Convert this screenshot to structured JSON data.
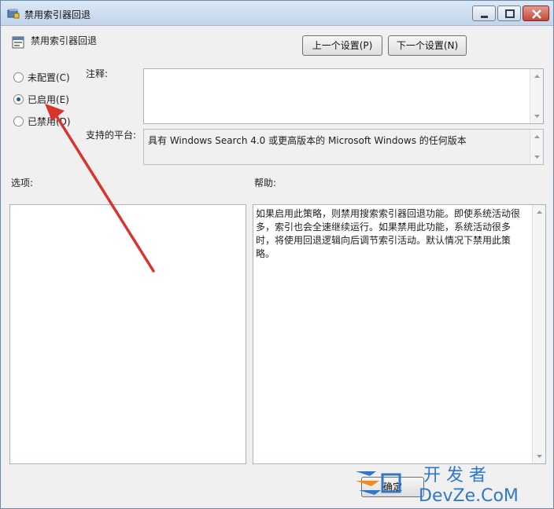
{
  "window": {
    "title": "禁用索引器回退"
  },
  "policy": {
    "name": "禁用索引器回退"
  },
  "nav": {
    "prev_label": "上一个设置(P)",
    "next_label": "下一个设置(N)"
  },
  "options": [
    {
      "label": "未配置(C)",
      "selected": false
    },
    {
      "label": "已启用(E)",
      "selected": true
    },
    {
      "label": "已禁用(D)",
      "selected": false
    }
  ],
  "comment": {
    "label": "注释:",
    "value": ""
  },
  "platform": {
    "label": "支持的平台:",
    "value": "具有 Windows Search 4.0 或更高版本的 Microsoft Windows 的任何版本"
  },
  "sections": {
    "options_label": "选项:",
    "help_label": "帮助:"
  },
  "help": {
    "text": "如果启用此策略，则禁用搜索索引器回退功能。即使系统活动很多，索引也会全速继续运行。如果禁用此功能，系统活动很多时，将使用回退逻辑向后调节索引活动。默认情况下禁用此策略。"
  },
  "footer": {
    "ok_label_partial": "确定"
  },
  "watermark": {
    "line1": "开 发 者",
    "line2": "DevZe.CoM"
  },
  "colors": {
    "arrow": "#d9342b",
    "watermark_blue": "#2f78c8",
    "watermark_orange": "#f08c1e"
  }
}
